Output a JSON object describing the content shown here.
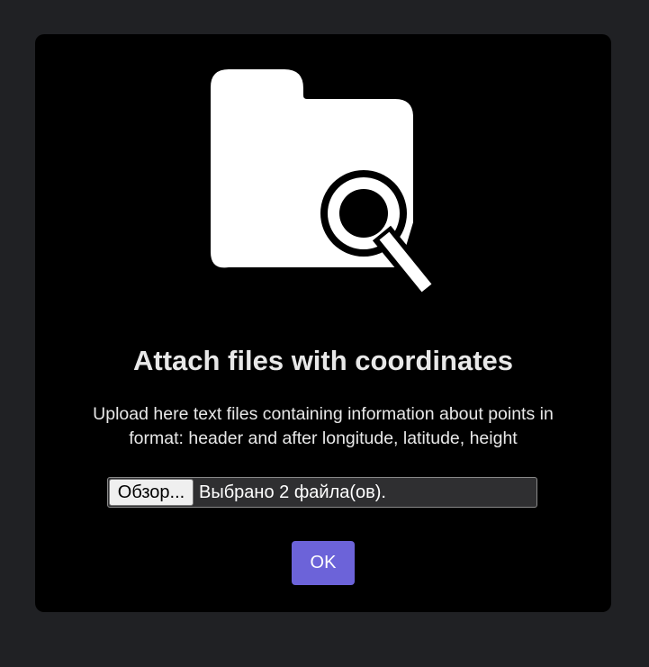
{
  "dialog": {
    "icon": "folder-search-icon",
    "title": "Attach files with coordinates",
    "description": "Upload here text files containing information about points in format: header and after longitude, latitude, height",
    "file_input": {
      "browse_label": "Обзор...",
      "status": "Выбрано 2 файла(ов)."
    },
    "ok_label": "OK"
  },
  "colors": {
    "page_background": "#202124",
    "dialog_background": "#000000",
    "accent": "#6c63d9",
    "text": "#e8e8e8"
  }
}
